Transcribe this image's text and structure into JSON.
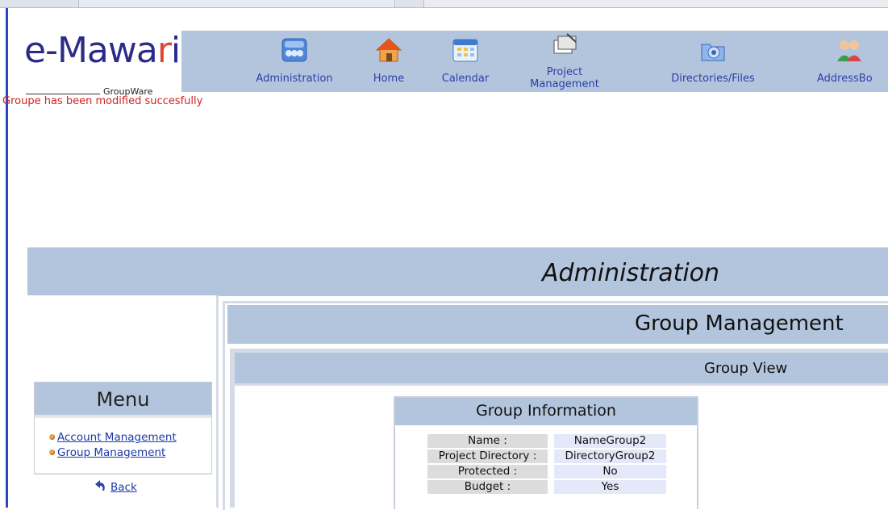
{
  "app": {
    "logo_main": "e-Mawa",
    "logo_accent": "r",
    "logo_tail": "i",
    "logo_sub": "GroupWare"
  },
  "nav": {
    "items": [
      {
        "label": "Administration",
        "icon": "admin-icon"
      },
      {
        "label": "Home",
        "icon": "house-icon"
      },
      {
        "label": "Calendar",
        "icon": "calendar-icon"
      },
      {
        "label": "Project Management",
        "icon": "project-icon"
      },
      {
        "label": "Directories/Files",
        "icon": "directories-icon"
      },
      {
        "label": "AddressBo",
        "icon": "addressbook-icon"
      }
    ]
  },
  "flash_message": "Groupe has been modified succesfully",
  "admin_title": "Administration",
  "menu": {
    "title": "Menu",
    "items": [
      "Account Management",
      "Group Management"
    ],
    "back_label": "Back"
  },
  "section_title": "Group Management",
  "subsection_title": "Group View",
  "group_info": {
    "title": "Group Information",
    "rows": [
      {
        "key": "Name :",
        "value": "NameGroup2"
      },
      {
        "key": "Project Directory :",
        "value": "DirectoryGroup2"
      },
      {
        "key": "Protected :",
        "value": "No"
      },
      {
        "key": "Budget :",
        "value": "Yes"
      }
    ]
  },
  "colors": {
    "banner": "#b3c5dd",
    "link": "#1c3aa6",
    "flash": "#d51f1f",
    "logo": "#2c2b8a",
    "logo_accent": "#e0453a"
  }
}
